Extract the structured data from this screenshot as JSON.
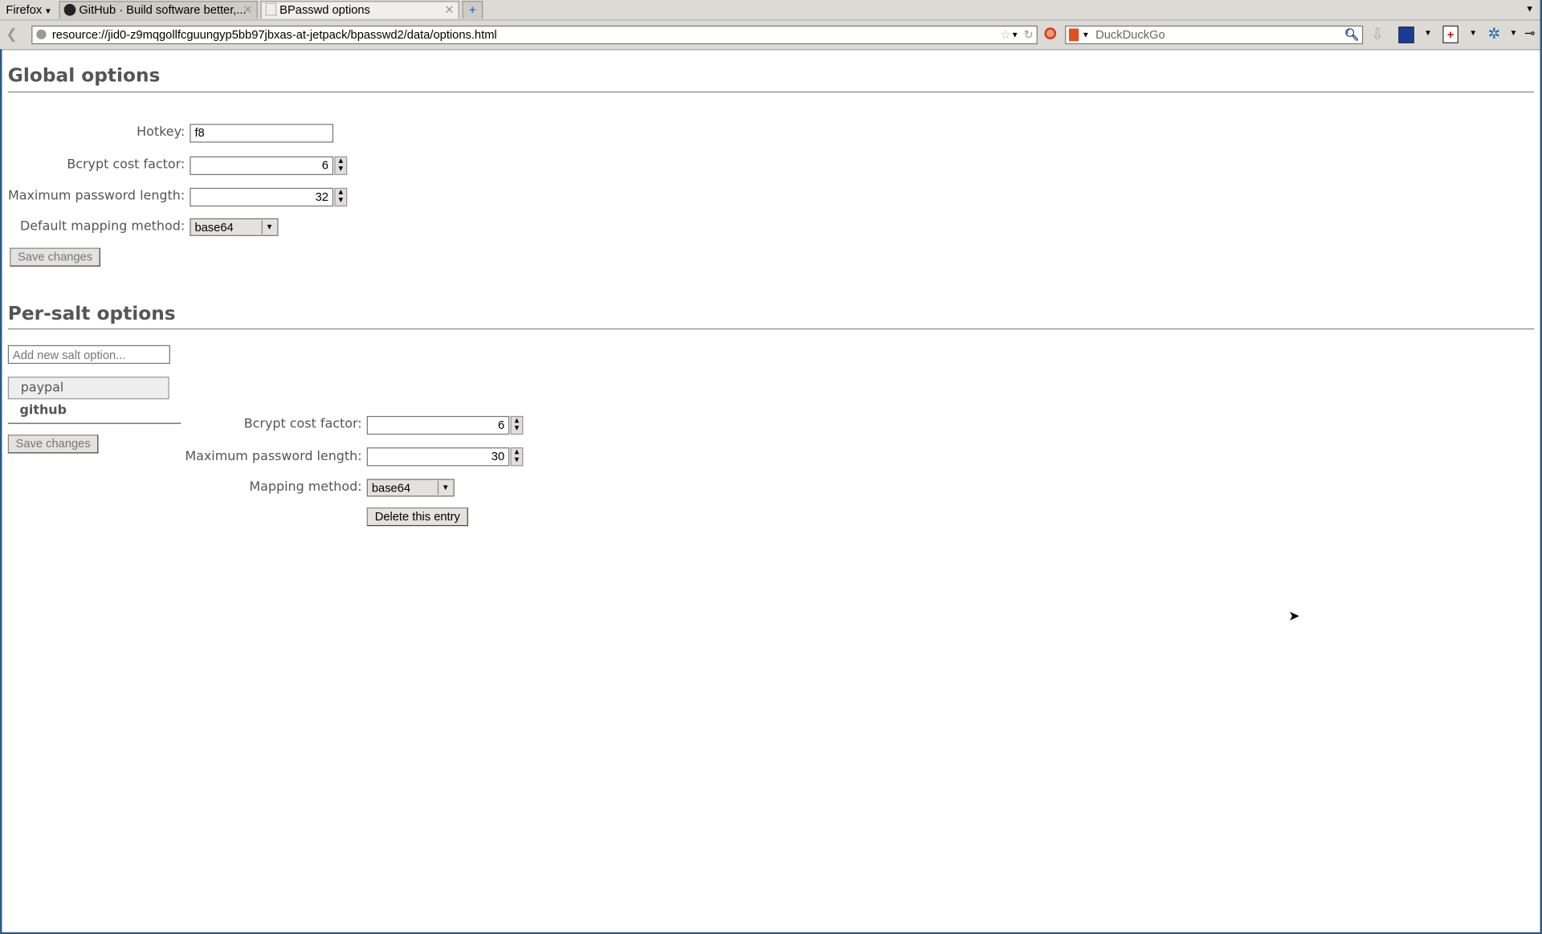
{
  "browser": {
    "menu_button": "Firefox",
    "tabs": [
      {
        "title": "GitHub · Build software better,...",
        "icon": "github-icon",
        "active": false
      },
      {
        "title": "BPasswd options",
        "icon": "blank-page-icon",
        "active": true
      }
    ],
    "url": "resource://jid0-z9mqgollfcguungyp5bb97jbxas-at-jetpack/bpasswd2/data/options.html",
    "search_engine": "DuckDuckGo",
    "search_placeholder": "DuckDuckGo"
  },
  "global": {
    "title": "Global options",
    "hotkey_label": "Hotkey:",
    "hotkey_value": "f8",
    "bcrypt_label": "Bcrypt cost factor:",
    "bcrypt_value": "6",
    "maxlen_label": "Maximum password length:",
    "maxlen_value": "32",
    "mapping_label": "Default mapping method:",
    "mapping_value": "base64",
    "save_label": "Save changes"
  },
  "per_salt": {
    "title": "Per-salt options",
    "add_placeholder": "Add new salt option...",
    "salts": [
      {
        "name": "paypal",
        "selected": false
      },
      {
        "name": "github",
        "selected": true
      }
    ],
    "save_label": "Save changes",
    "bcrypt_label": "Bcrypt cost factor:",
    "bcrypt_value": "6",
    "maxlen_label": "Maximum password length:",
    "maxlen_value": "30",
    "mapping_label": "Mapping method:",
    "mapping_value": "base64",
    "delete_label": "Delete this entry"
  }
}
